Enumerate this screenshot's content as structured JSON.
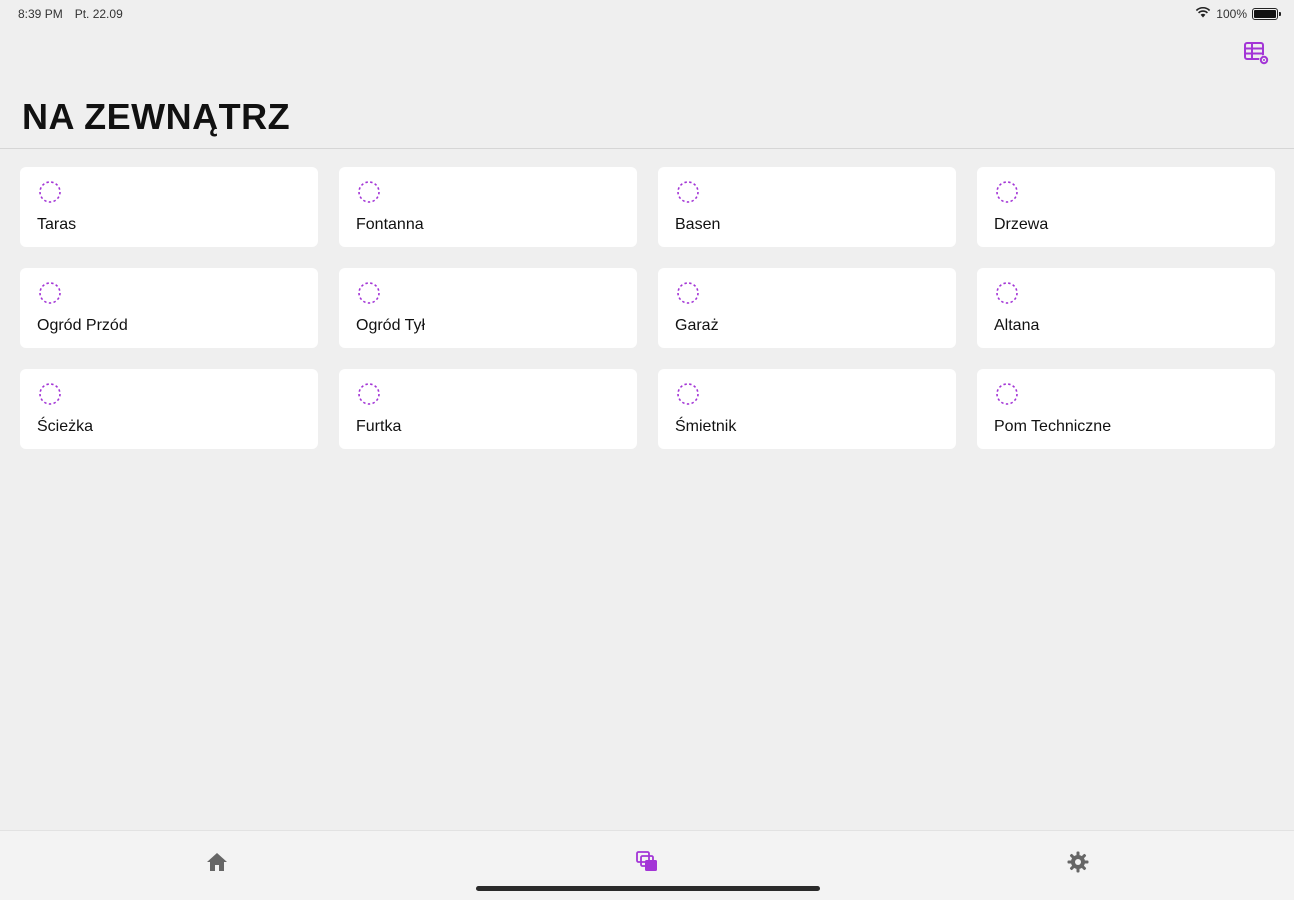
{
  "status_bar": {
    "time": "8:39 PM",
    "date": "Pt. 22.09",
    "battery": "100%"
  },
  "header": {
    "title": "NA ZEWNĄTRZ",
    "edit_icon": "grid-edit-icon"
  },
  "rooms": [
    {
      "label": "Taras"
    },
    {
      "label": "Fontanna"
    },
    {
      "label": "Basen"
    },
    {
      "label": "Drzewa"
    },
    {
      "label": "Ogród Przód"
    },
    {
      "label": "Ogród Tył"
    },
    {
      "label": "Garaż"
    },
    {
      "label": "Altana"
    },
    {
      "label": "Ścieżka"
    },
    {
      "label": "Furtka"
    },
    {
      "label": "Śmietnik"
    },
    {
      "label": "Pom Techniczne"
    }
  ],
  "tab_bar": {
    "tabs": [
      {
        "icon": "home-icon",
        "active": false
      },
      {
        "icon": "rooms-icon",
        "active": true
      },
      {
        "icon": "gear-icon",
        "active": false
      }
    ]
  },
  "colors": {
    "accent": "#a335d6",
    "background": "#efefef",
    "card": "#ffffff",
    "inactive_icon": "#666666"
  }
}
